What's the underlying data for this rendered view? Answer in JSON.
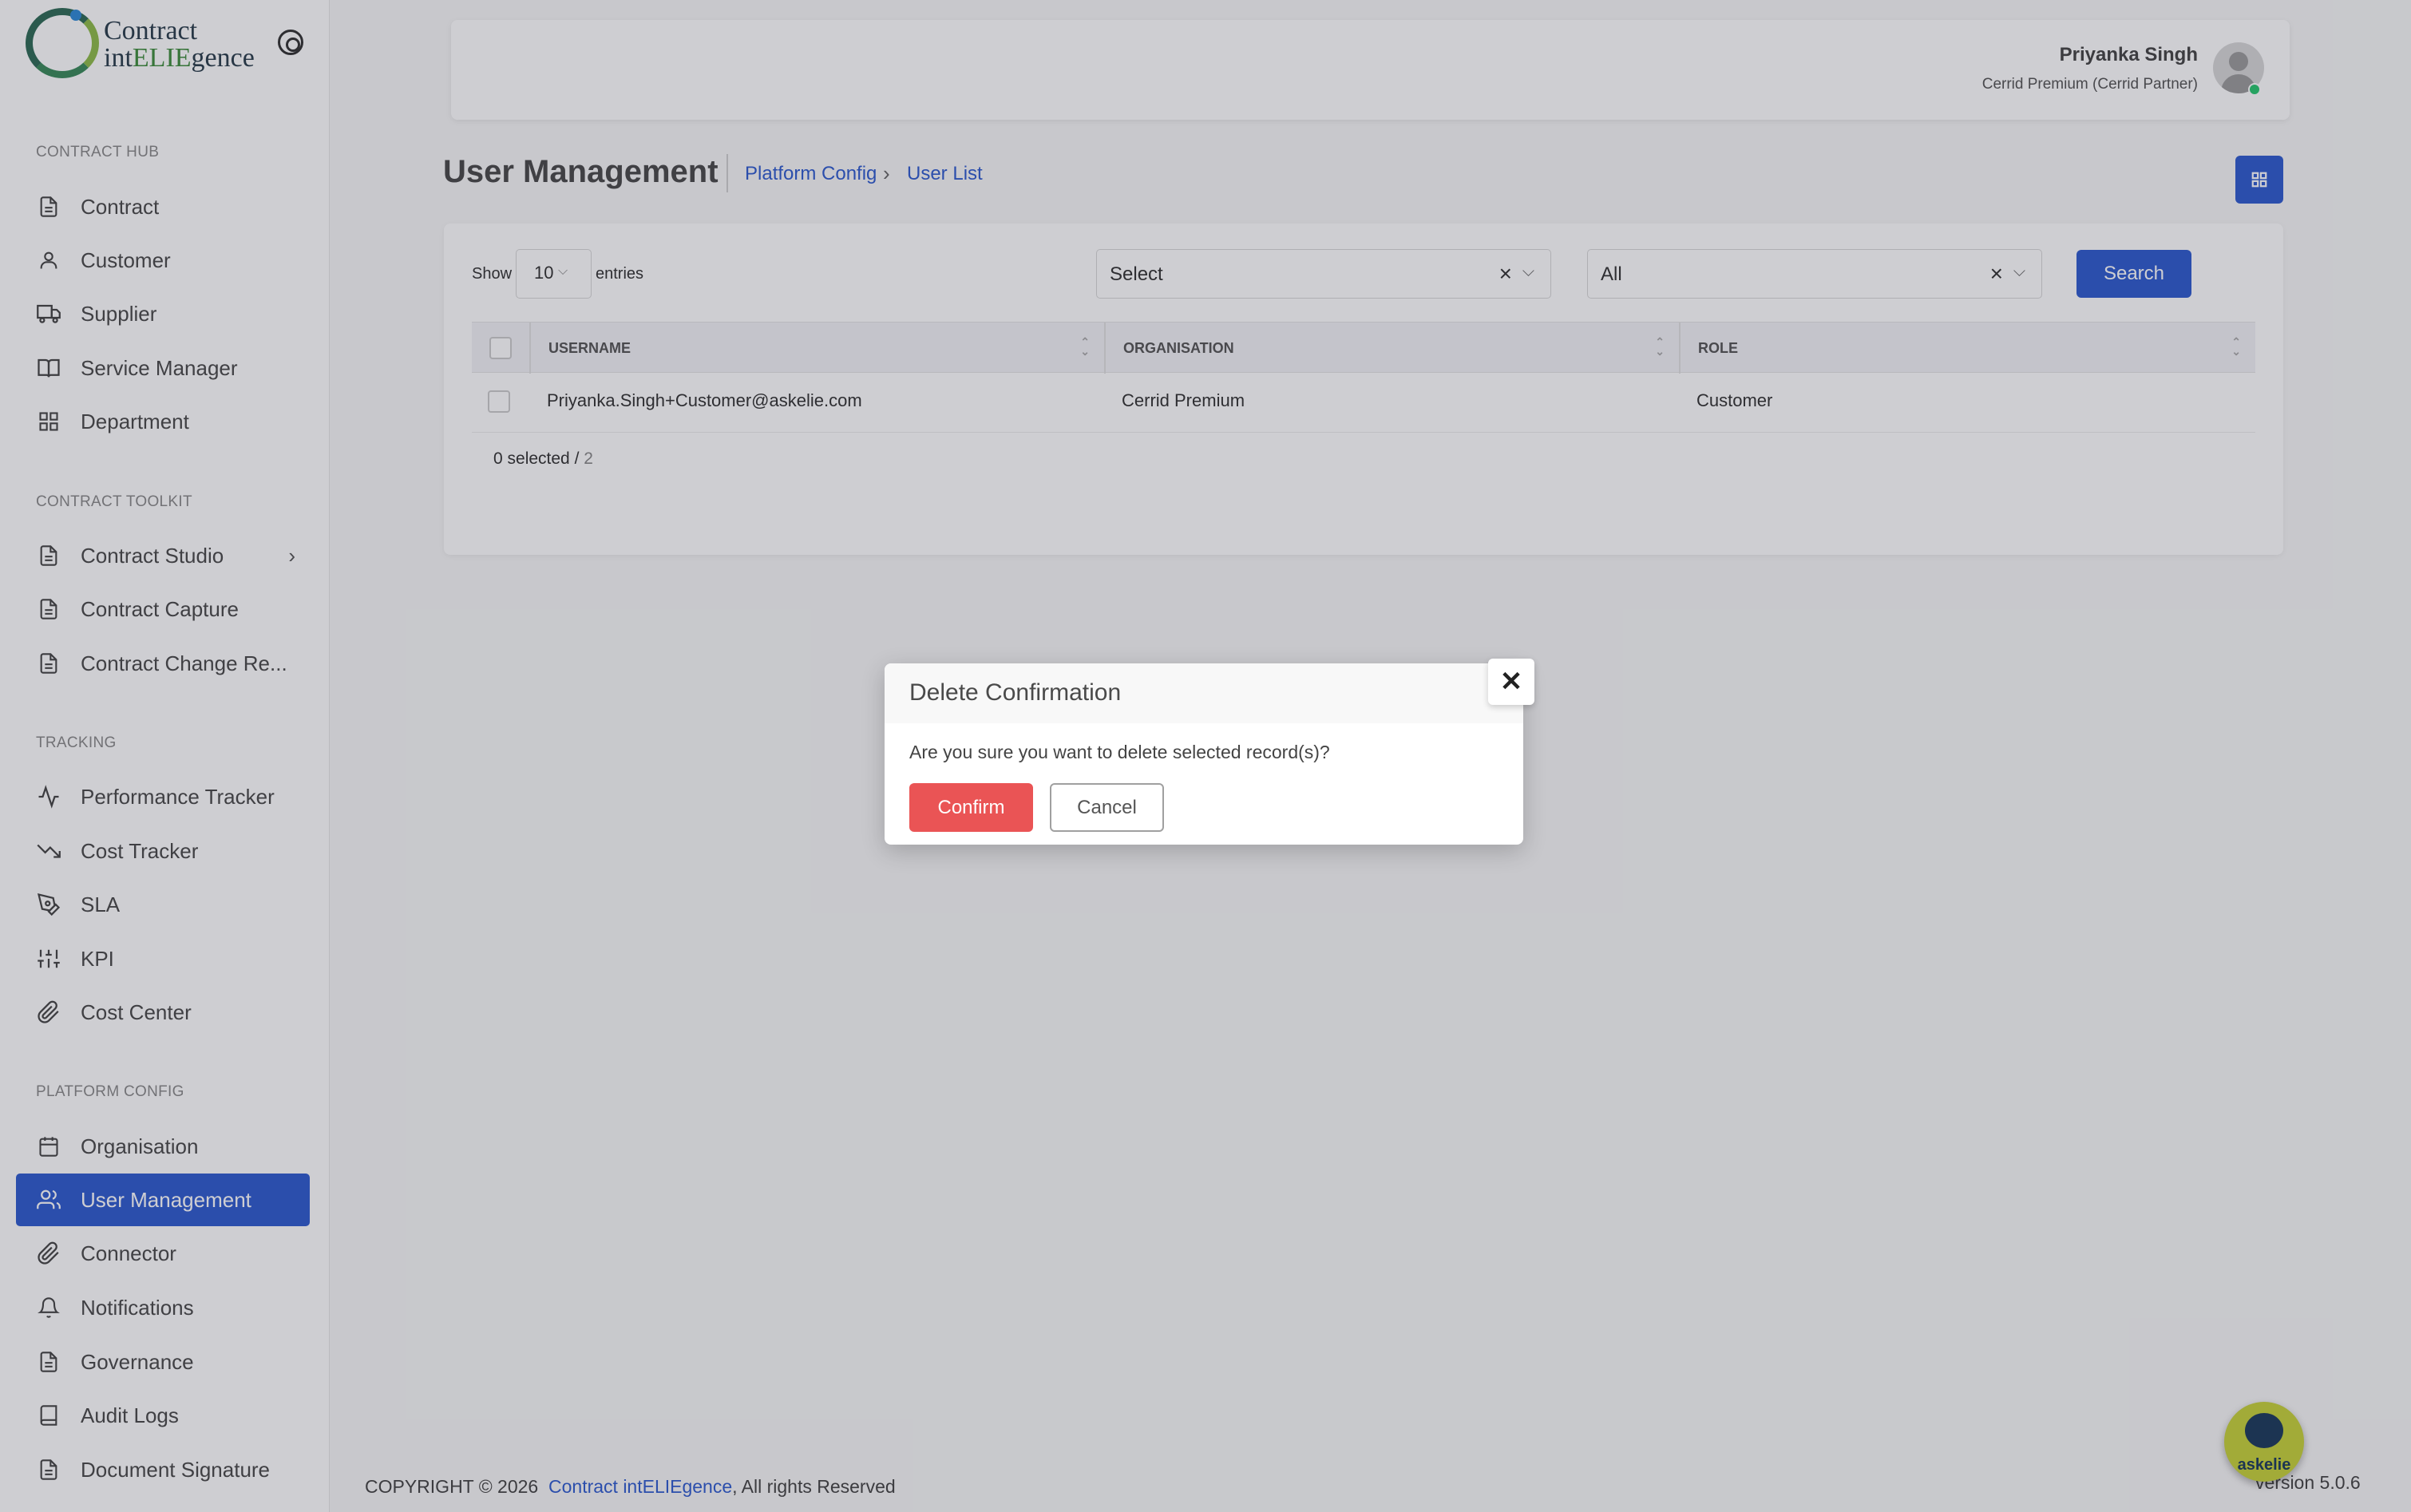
{
  "app": {
    "logo_line1": "Contract",
    "logo_line2_a": "int",
    "logo_line2_b": "ELIE",
    "logo_line2_c": "gence"
  },
  "sidebar": {
    "sections": [
      {
        "label": "CONTRACT HUB",
        "items": [
          {
            "label": "Contract",
            "icon": "document-icon"
          },
          {
            "label": "Customer",
            "icon": "user-icon"
          },
          {
            "label": "Supplier",
            "icon": "truck-icon"
          },
          {
            "label": "Service Manager",
            "icon": "book-open-icon"
          },
          {
            "label": "Department",
            "icon": "grid-icon"
          }
        ]
      },
      {
        "label": "CONTRACT TOOLKIT",
        "items": [
          {
            "label": "Contract Studio",
            "icon": "document-icon"
          },
          {
            "label": "Contract Capture",
            "icon": "document-icon"
          },
          {
            "label": "Contract Change Re...",
            "icon": "document-icon"
          }
        ]
      },
      {
        "label": "TRACKING",
        "items": [
          {
            "label": "Performance Tracker",
            "icon": "activity-icon"
          },
          {
            "label": "Cost Tracker",
            "icon": "trending-down-icon"
          },
          {
            "label": "SLA",
            "icon": "pen-tool-icon"
          },
          {
            "label": "KPI",
            "icon": "sliders-icon"
          },
          {
            "label": "Cost Center",
            "icon": "paperclip-icon"
          }
        ]
      },
      {
        "label": "PLATFORM CONFIG",
        "items": [
          {
            "label": "Organisation",
            "icon": "calendar-icon"
          },
          {
            "label": "User Management",
            "icon": "users-icon",
            "active": true
          },
          {
            "label": "Connector",
            "icon": "paperclip-icon"
          },
          {
            "label": "Notifications",
            "icon": "bell-icon"
          },
          {
            "label": "Governance",
            "icon": "document-icon"
          },
          {
            "label": "Audit Logs",
            "icon": "book-icon"
          },
          {
            "label": "Document Signature",
            "icon": "document-icon"
          }
        ]
      }
    ]
  },
  "header": {
    "user_name": "Priyanka Singh",
    "user_org": "Cerrid Premium (Cerrid Partner)"
  },
  "page": {
    "title": "User Management",
    "breadcrumb": [
      "Platform Config",
      "User List"
    ]
  },
  "filters": {
    "show_label": "Show",
    "entries_value": "10",
    "entries_label": "entries",
    "filter1_value": "Select",
    "filter2_value": "All",
    "search_label": "Search"
  },
  "table": {
    "columns": [
      "USERNAME",
      "ORGANISATION",
      "ROLE"
    ],
    "rows": [
      {
        "username": "Priyanka.Singh+Customer@askelie.com",
        "organisation": "Cerrid Premium",
        "role": "Customer"
      }
    ],
    "selected_text": "0 selected / ",
    "total": "2"
  },
  "footer": {
    "copyright": "COPYRIGHT © 2026",
    "brand": "Contract intELIEgence",
    "rights": ", All rights Reserved",
    "version": "version 5.0.6",
    "chatbot_label": "askelie"
  },
  "modal": {
    "title": "Delete Confirmation",
    "message": "Are you sure you want to delete selected record(s)?",
    "confirm_label": "Confirm",
    "cancel_label": "Cancel",
    "close_glyph": "✕"
  },
  "colors": {
    "primary": "#2f5bcf",
    "danger": "#ea5455",
    "online": "#28c76f"
  }
}
